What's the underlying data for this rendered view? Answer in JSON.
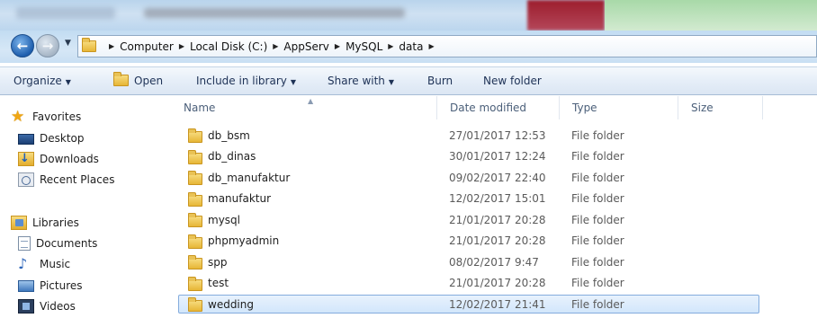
{
  "address_bar": {
    "breadcrumbs": [
      "Computer",
      "Local Disk (C:)",
      "AppServ",
      "MySQL",
      "data"
    ]
  },
  "toolbar": {
    "organize_label": "Organize",
    "open_label": "Open",
    "include_label": "Include in library",
    "share_label": "Share with",
    "burn_label": "Burn",
    "new_folder_label": "New folder"
  },
  "navigation": {
    "favorites": {
      "label": "Favorites",
      "items": [
        {
          "label": "Desktop",
          "icon": "desktop-icon"
        },
        {
          "label": "Downloads",
          "icon": "downloads-icon"
        },
        {
          "label": "Recent Places",
          "icon": "recent-places-icon"
        }
      ]
    },
    "libraries": {
      "label": "Libraries",
      "items": [
        {
          "label": "Documents",
          "icon": "documents-icon"
        },
        {
          "label": "Music",
          "icon": "music-icon"
        },
        {
          "label": "Pictures",
          "icon": "pictures-icon"
        },
        {
          "label": "Videos",
          "icon": "videos-icon"
        }
      ]
    }
  },
  "columns": {
    "name": "Name",
    "date": "Date modified",
    "type": "Type",
    "size": "Size"
  },
  "files": [
    {
      "name": "db_bsm",
      "date": "27/01/2017 12:53",
      "type": "File folder"
    },
    {
      "name": "db_dinas",
      "date": "30/01/2017 12:24",
      "type": "File folder"
    },
    {
      "name": "db_manufaktur",
      "date": "09/02/2017 22:40",
      "type": "File folder"
    },
    {
      "name": "manufaktur",
      "date": "12/02/2017 15:01",
      "type": "File folder"
    },
    {
      "name": "mysql",
      "date": "21/01/2017 20:28",
      "type": "File folder"
    },
    {
      "name": "phpmyadmin",
      "date": "21/01/2017 20:28",
      "type": "File folder"
    },
    {
      "name": "spp",
      "date": "08/02/2017 9:47",
      "type": "File folder"
    },
    {
      "name": "test",
      "date": "21/01/2017 20:28",
      "type": "File folder"
    },
    {
      "name": "wedding",
      "date": "12/02/2017 21:41",
      "type": "File folder",
      "selected": true
    }
  ],
  "colors": {
    "selection": "#d2e6fb",
    "selection_border": "#84acdd",
    "toolbar_text": "#1e3256",
    "folder": "#e7b636"
  }
}
